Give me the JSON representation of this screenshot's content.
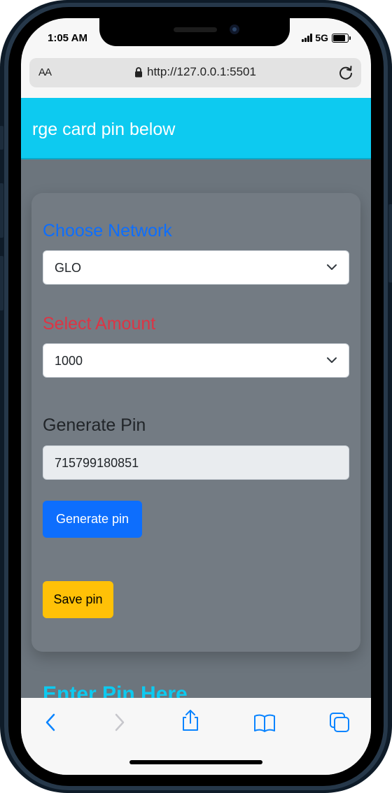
{
  "status_bar": {
    "time": "1:05 AM",
    "network": "5G"
  },
  "browser": {
    "text_size_label": "AA",
    "url": "http://127.0.0.1:5501"
  },
  "header": {
    "text": "rge card pin below"
  },
  "form": {
    "network_label": "Choose Network",
    "network_value": "GLO",
    "amount_label": "Select Amount",
    "amount_value": "1000",
    "generate_label": "Generate Pin",
    "pin_value": "715799180851",
    "generate_button": "Generate pin",
    "save_button": "Save pin"
  },
  "enter_pin_heading": "Enter Pin Here",
  "colors": {
    "header_bg": "#0dcaf0",
    "page_bg": "#6c757d",
    "primary": "#0d6efd",
    "danger": "#dc3545",
    "warning": "#ffc107",
    "ios_blue": "#0a84ff"
  },
  "toolbar_icons": [
    "back-chevron-icon",
    "forward-chevron-icon",
    "share-icon",
    "bookmarks-icon",
    "tabs-icon"
  ]
}
